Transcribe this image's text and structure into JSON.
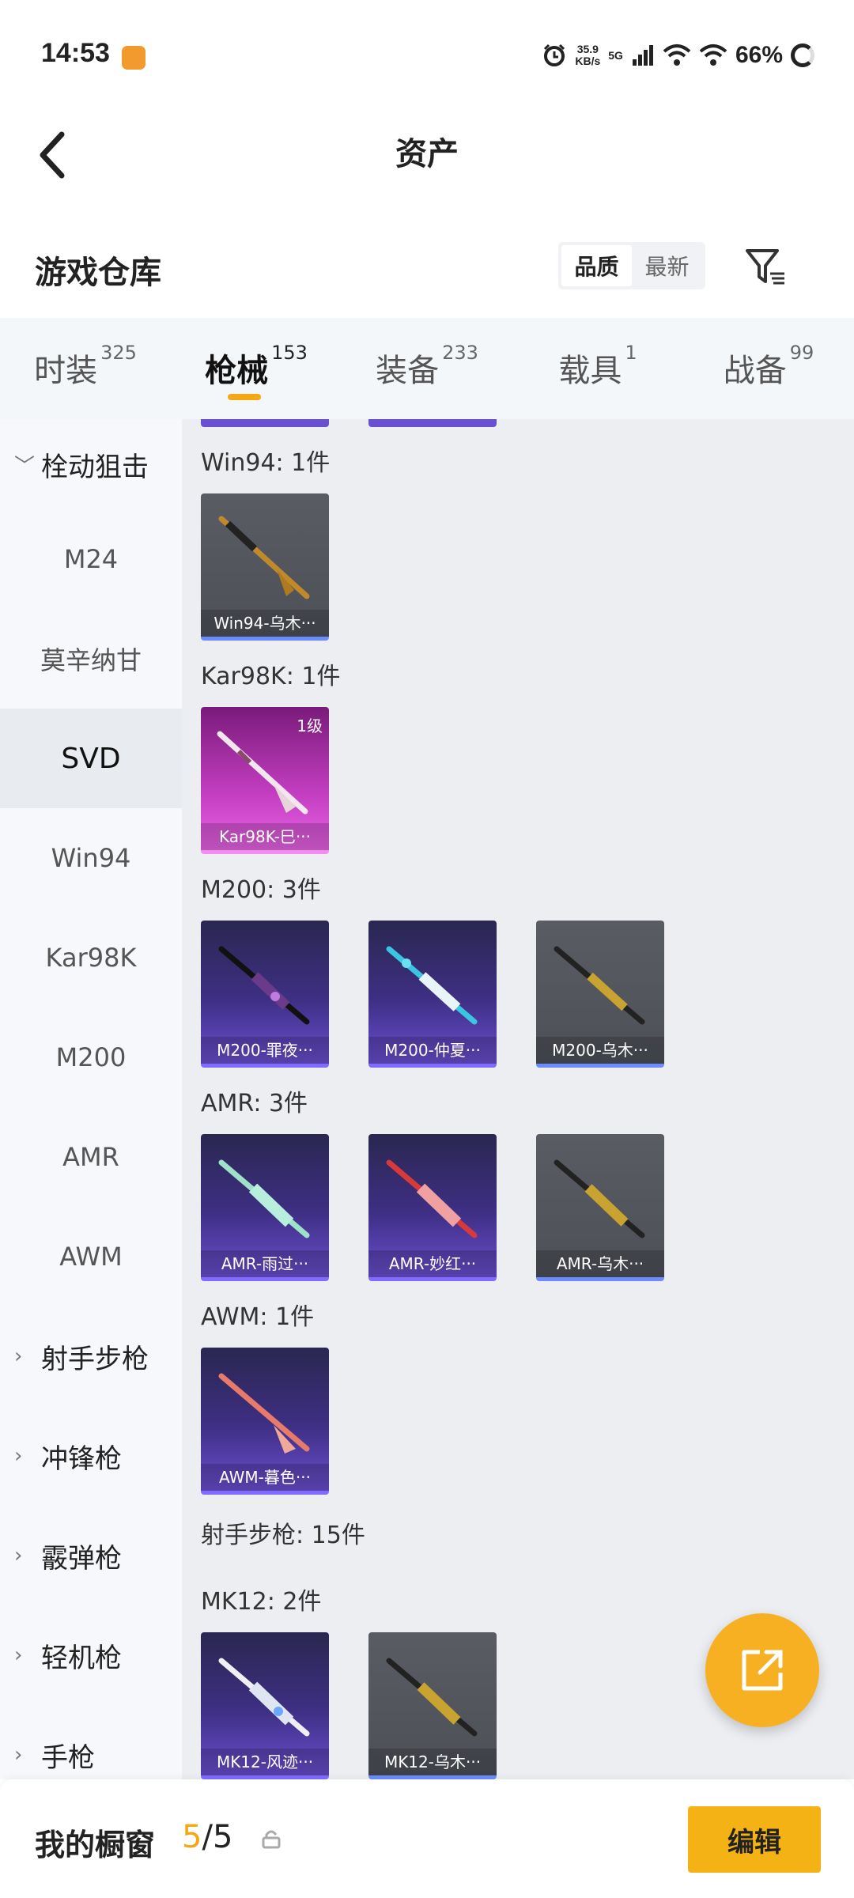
{
  "status_bar": {
    "time": "14:53",
    "net_speed_value": "35.9",
    "net_speed_unit": "KB/s",
    "signal_label": "5G",
    "battery": "66%"
  },
  "header": {
    "title": "资产"
  },
  "warehouse": {
    "title": "游戏仓库",
    "sort_quality": "品质",
    "sort_newest": "最新"
  },
  "tabs": [
    {
      "label": "时装",
      "count": "325"
    },
    {
      "label": "枪械",
      "count": "153"
    },
    {
      "label": "装备",
      "count": "233"
    },
    {
      "label": "载具",
      "count": "1"
    },
    {
      "label": "战备",
      "count": "99"
    }
  ],
  "sidebar": {
    "items": [
      {
        "label": "栓动狙击"
      },
      {
        "label": "M24"
      },
      {
        "label": "莫辛纳甘"
      },
      {
        "label": "SVD"
      },
      {
        "label": "Win94"
      },
      {
        "label": "Kar98K"
      },
      {
        "label": "M200"
      },
      {
        "label": "AMR"
      },
      {
        "label": "AWM"
      },
      {
        "label": "射手步枪"
      },
      {
        "label": "冲锋枪"
      },
      {
        "label": "霰弹枪"
      },
      {
        "label": "轻机枪"
      },
      {
        "label": "手枪"
      }
    ]
  },
  "content": {
    "sections": [
      {
        "label": "Win94: 1件",
        "items": [
          {
            "name": "Win94-乌木···"
          }
        ]
      },
      {
        "label": "Kar98K: 1件",
        "items": [
          {
            "name": "Kar98K-巳···",
            "level": "1级"
          }
        ]
      },
      {
        "label": "M200: 3件",
        "items": [
          {
            "name": "M200-罪夜···"
          },
          {
            "name": "M200-仲夏···"
          },
          {
            "name": "M200-乌木···"
          }
        ]
      },
      {
        "label": "AMR: 3件",
        "items": [
          {
            "name": "AMR-雨过···"
          },
          {
            "name": "AMR-妙红···"
          },
          {
            "name": "AMR-乌木···"
          }
        ]
      },
      {
        "label": "AWM: 1件",
        "items": [
          {
            "name": "AWM-暮色···"
          }
        ]
      },
      {
        "label": "射手步枪: 15件"
      },
      {
        "label": "MK12: 2件",
        "items": [
          {
            "name": "MK12-风迹···"
          },
          {
            "name": "MK12-乌木···"
          }
        ]
      }
    ]
  },
  "showcase": {
    "label": "我的橱窗",
    "current": "5",
    "separator": "/",
    "total": "5",
    "edit_label": "编辑"
  },
  "icons": {
    "back": "back-arrow-icon",
    "filter": "filter-icon",
    "share": "share-external-icon",
    "lock": "lock-icon"
  },
  "colors": {
    "accent": "#f5b214",
    "tab_indicator": "#f5a815"
  }
}
